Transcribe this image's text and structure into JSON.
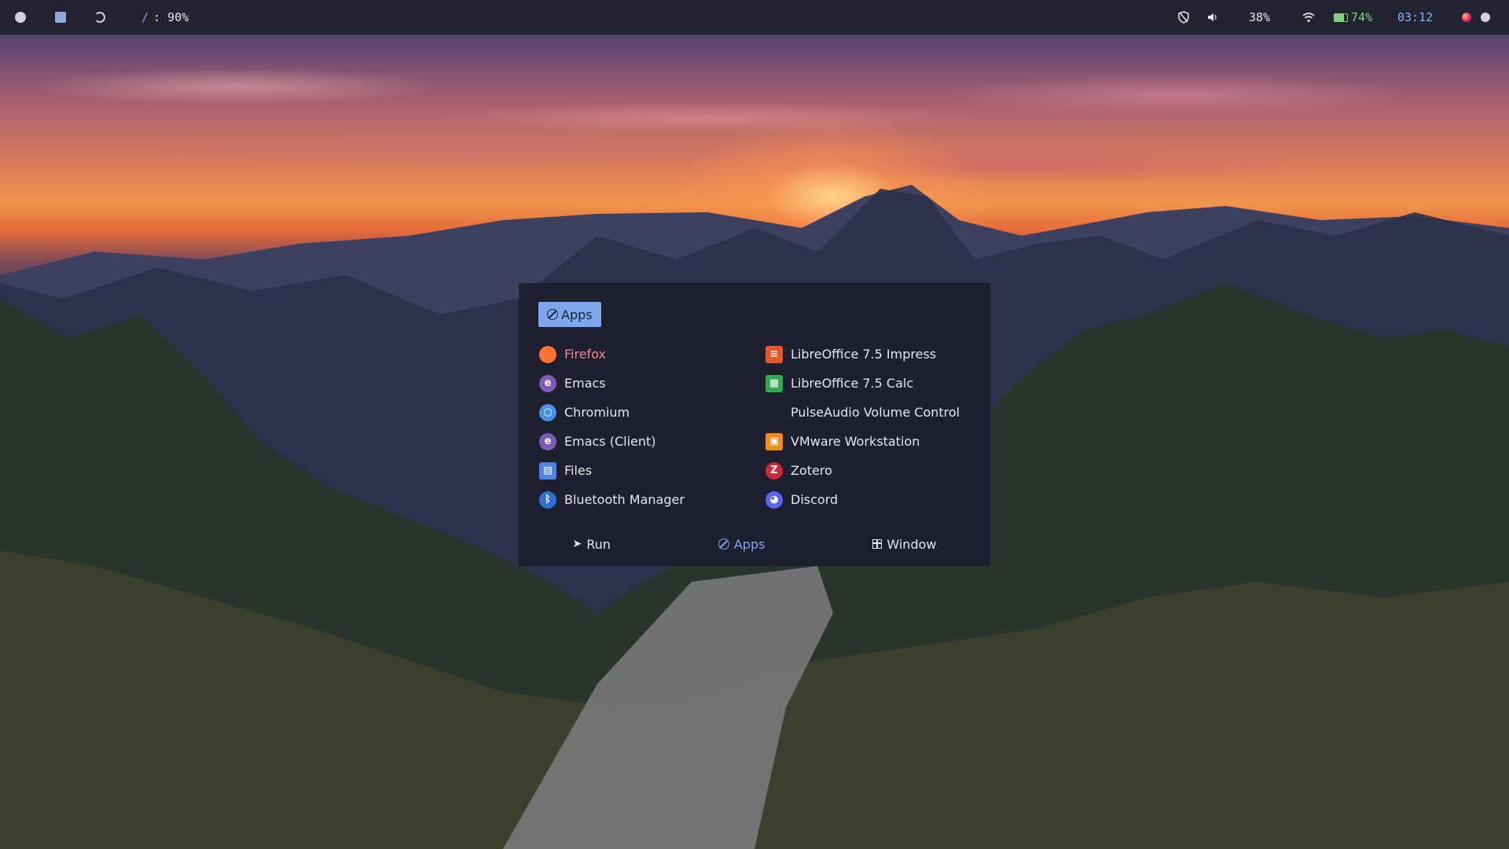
{
  "topbar": {
    "workspaces": [
      {
        "icon": "arch-logo-icon"
      },
      {
        "icon": "monitor-icon"
      },
      {
        "icon": "moon-icon"
      }
    ],
    "disk": {
      "icon": "slash",
      "label": "/",
      "value": ": 90%"
    },
    "vpn_icon": "shield-off-icon",
    "volume": {
      "icon": "speaker-icon",
      "value": "38%"
    },
    "wifi_icon": "wifi-icon",
    "battery": {
      "value": "74%",
      "color": "#7fd07f"
    },
    "clock": "03:12",
    "tray": [
      "firefox-tray-icon",
      "steam-tray-icon"
    ]
  },
  "launcher": {
    "mode_badge": "Apps",
    "apps": [
      {
        "label": "Firefox",
        "icon": "firefox-icon",
        "color": "#ff7139",
        "selected": true
      },
      {
        "label": "Emacs",
        "icon": "emacs-icon",
        "color": "#7f5ab6"
      },
      {
        "label": "Chromium",
        "icon": "chromium-icon",
        "color": "#4a90e2"
      },
      {
        "label": "Emacs (Client)",
        "icon": "emacs-client-icon",
        "color": "#7f5ab6"
      },
      {
        "label": "Files",
        "icon": "files-icon",
        "color": "#4a86e8"
      },
      {
        "label": "Bluetooth Manager",
        "icon": "bluetooth-icon",
        "color": "#2f6fd6"
      },
      {
        "label": "LibreOffice 7.5 Impress",
        "icon": "libreoffice-impress-icon",
        "color": "#e6572a"
      },
      {
        "label": "LibreOffice 7.5 Calc",
        "icon": "libreoffice-calc-icon",
        "color": "#2fa84f"
      },
      {
        "label": "PulseAudio Volume Control",
        "icon": "none",
        "color": "transparent"
      },
      {
        "label": "VMware Workstation",
        "icon": "vmware-icon",
        "color": "#f08c1a"
      },
      {
        "label": "Zotero",
        "icon": "zotero-icon",
        "color": "#cc2936"
      },
      {
        "label": "Discord",
        "icon": "discord-icon",
        "color": "#5865f2"
      }
    ],
    "modes": [
      {
        "label": "Run",
        "icon": "rocket-icon",
        "active": false
      },
      {
        "label": "Apps",
        "icon": "circle-slash-icon",
        "active": true
      },
      {
        "label": "Window",
        "icon": "window-icon",
        "active": false
      }
    ],
    "colors": {
      "accent": "#7ea7f0",
      "selected_text": "#f08a9c",
      "background": "#1e1f2e"
    }
  }
}
